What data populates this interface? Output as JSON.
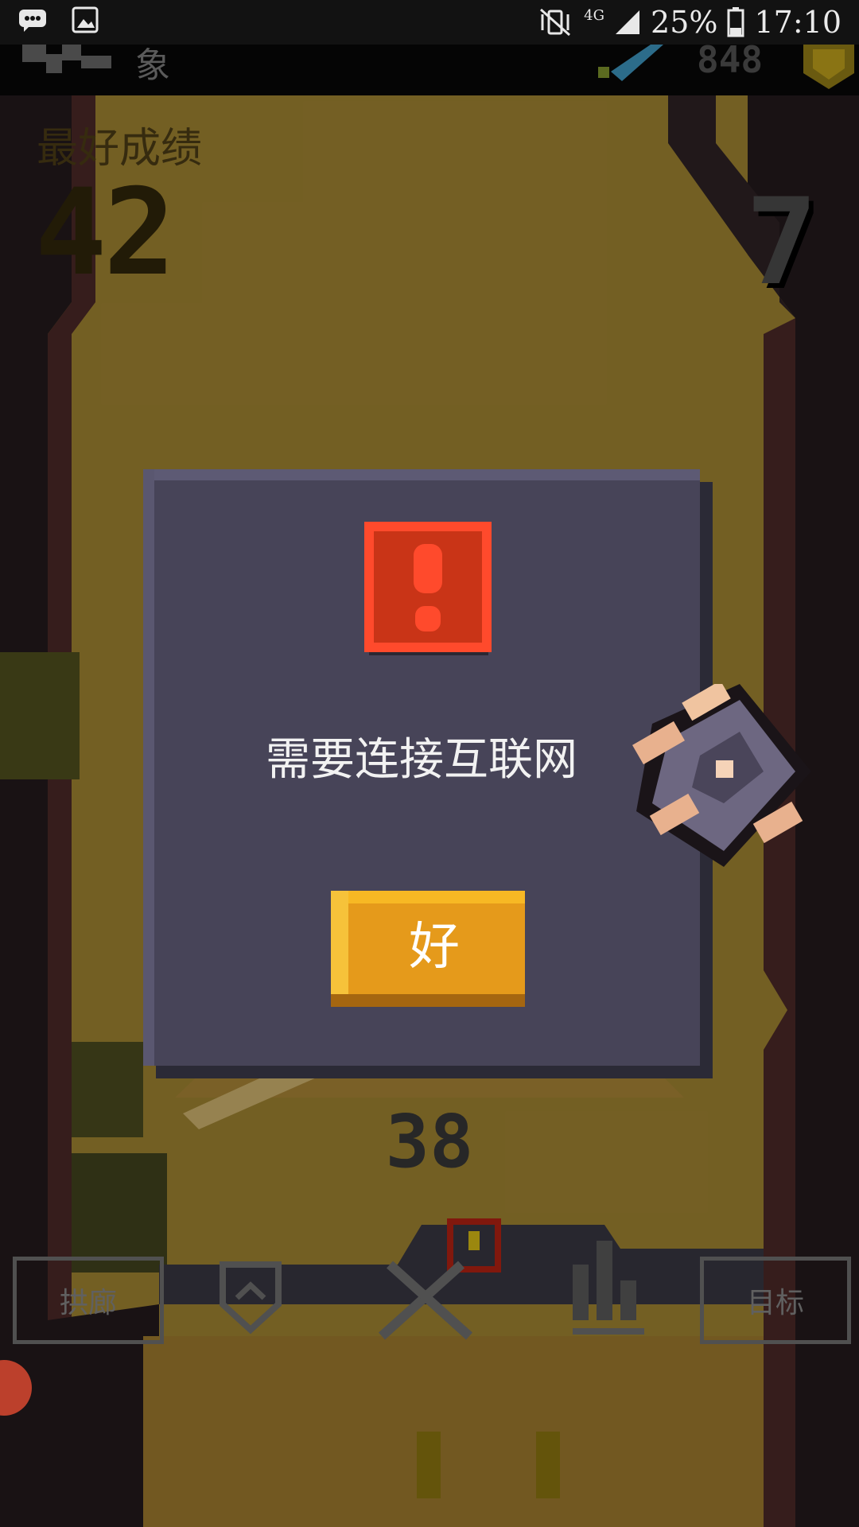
{
  "status_bar": {
    "network": "4G",
    "battery": "25%",
    "time": "17:10"
  },
  "topbar": {
    "title": "象",
    "coins": "848"
  },
  "game": {
    "best_label": "最好成绩",
    "best_score": "42",
    "current_score": "7",
    "mid_score": "38",
    "nav_left_label": "拱廊",
    "nav_right_label": "目标"
  },
  "dialog": {
    "message": "需要连接互联网",
    "ok_label": "好"
  },
  "colors": {
    "dialog_bg": "#474458",
    "alert_red": "#d8361b",
    "button_gold": "#e59a1b"
  },
  "icons": [
    "chat-bubble-icon",
    "image-icon",
    "vibrate-mute-icon",
    "signal-icon",
    "battery-icon",
    "alert-icon",
    "player-sprite"
  ]
}
